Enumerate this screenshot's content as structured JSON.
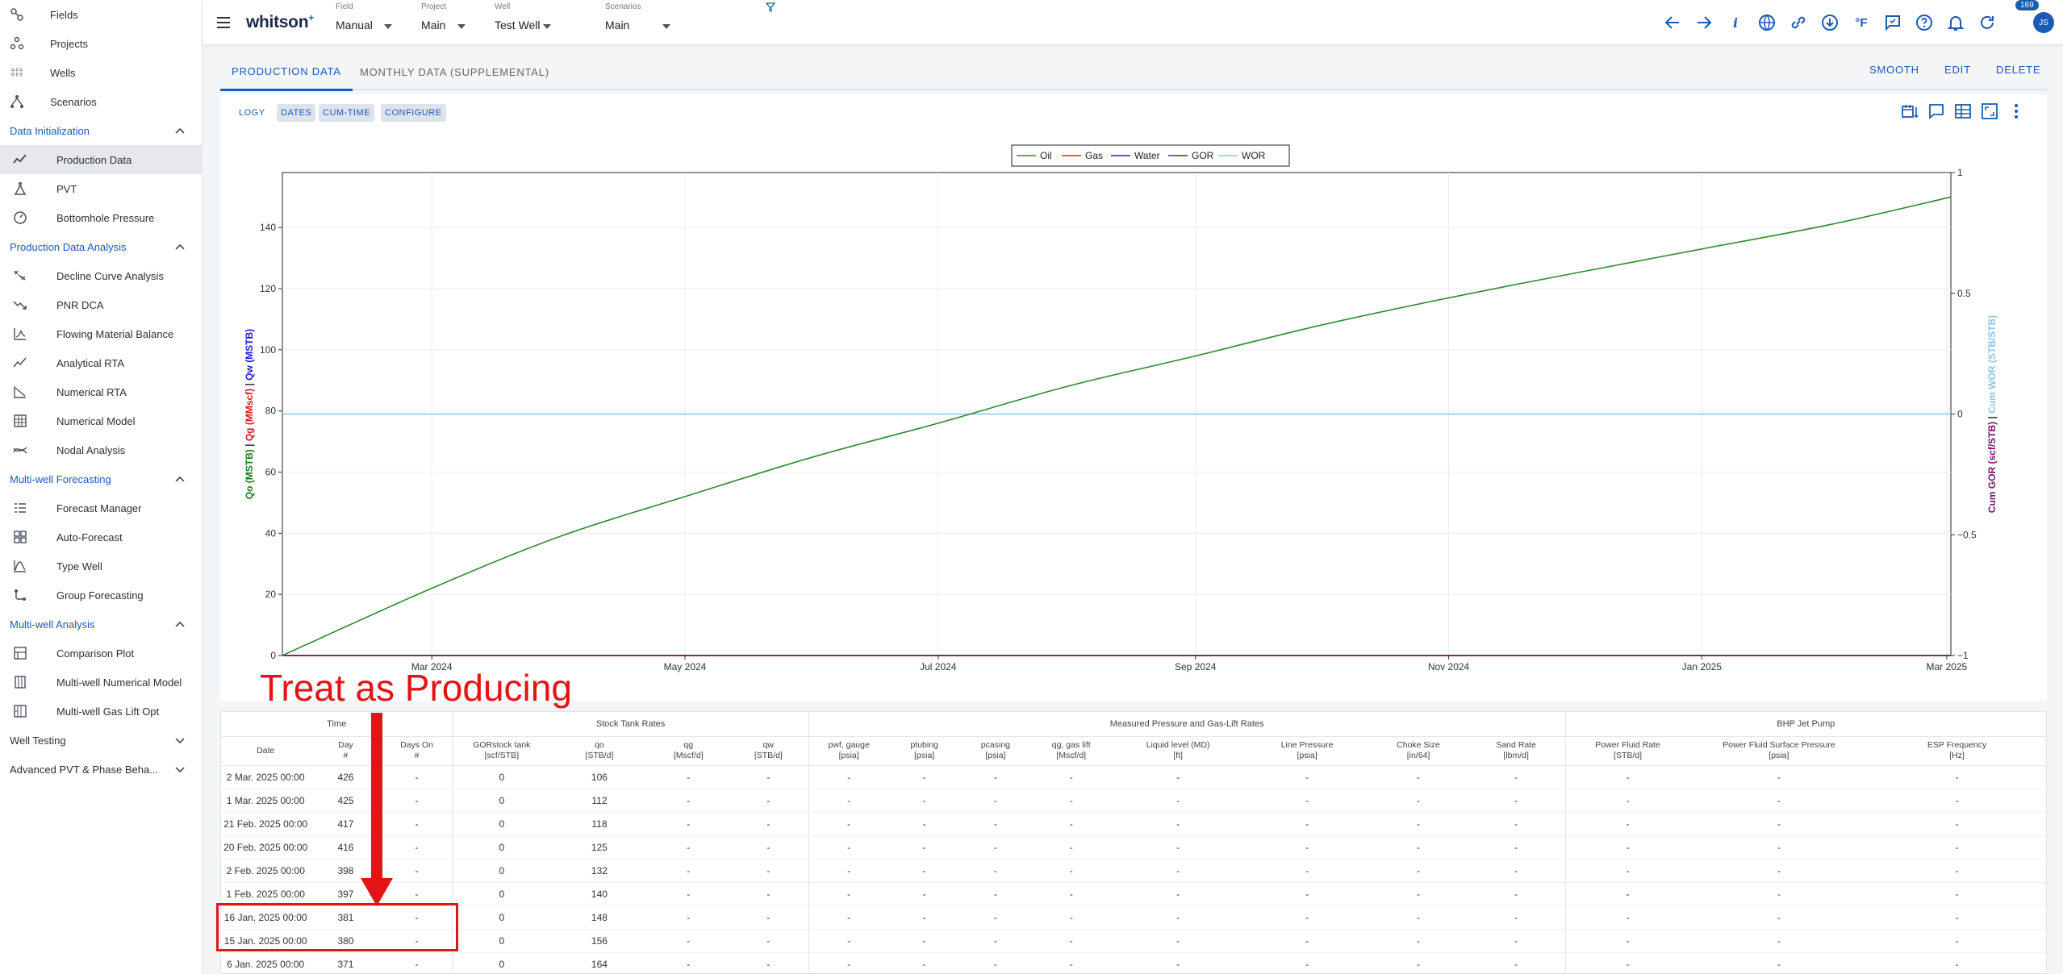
{
  "sidebar": {
    "top_items": [
      {
        "label": "Fields",
        "icon": "fields-icon"
      },
      {
        "label": "Projects",
        "icon": "projects-icon"
      },
      {
        "label": "Wells",
        "icon": "wells-icon"
      },
      {
        "label": "Scenarios",
        "icon": "scenarios-icon"
      }
    ],
    "sections": [
      {
        "title": "Data Initialization",
        "expanded": true,
        "items": [
          {
            "label": "Production Data",
            "icon": "production-chart-icon",
            "active": true
          },
          {
            "label": "PVT",
            "icon": "flask-icon"
          },
          {
            "label": "Bottomhole Pressure",
            "icon": "gauge-icon"
          }
        ]
      },
      {
        "title": "Production Data Analysis",
        "expanded": true,
        "items": [
          {
            "label": "Decline Curve Analysis",
            "icon": "decline-icon"
          },
          {
            "label": "PNR DCA",
            "icon": "trend-down-icon"
          },
          {
            "label": "Flowing Material Balance",
            "icon": "fmb-chart-icon"
          },
          {
            "label": "Analytical RTA",
            "icon": "line-chart-icon"
          },
          {
            "label": "Numerical RTA",
            "icon": "numerical-rta-icon"
          },
          {
            "label": "Numerical Model",
            "icon": "building-icon"
          },
          {
            "label": "Nodal Analysis",
            "icon": "nodal-icon"
          }
        ]
      },
      {
        "title": "Multi-well Forecasting",
        "expanded": true,
        "items": [
          {
            "label": "Forecast Manager",
            "icon": "list-icon"
          },
          {
            "label": "Auto-Forecast",
            "icon": "grid-icon"
          },
          {
            "label": "Type Well",
            "icon": "type-well-icon"
          },
          {
            "label": "Group Forecasting",
            "icon": "group-icon"
          }
        ]
      },
      {
        "title": "Multi-well Analysis",
        "expanded": true,
        "items": [
          {
            "label": "Comparison Plot",
            "icon": "comparison-icon"
          },
          {
            "label": "Multi-well Numerical Model",
            "icon": "multiwell-model-icon"
          },
          {
            "label": "Multi-well Gas Lift Opt",
            "icon": "gas-lift-icon"
          }
        ]
      },
      {
        "title": "Well Testing",
        "expanded": false,
        "items": []
      },
      {
        "title": "Advanced PVT & Phase Beha...",
        "expanded": false,
        "items": []
      }
    ]
  },
  "topbar": {
    "logo": "whitson",
    "logo_sup": "+",
    "selectors": [
      {
        "label": "Field",
        "value": "Manual"
      },
      {
        "label": "Project",
        "value": "Main"
      },
      {
        "label": "Well",
        "value": "Test Well"
      },
      {
        "label": "Scenarios",
        "value": "Main"
      }
    ],
    "notification_count": "169",
    "avatar_initials": "JS",
    "temp_unit": "°F",
    "info_glyph": "i"
  },
  "tabs": [
    {
      "label": "PRODUCTION DATA",
      "active": true
    },
    {
      "label": "MONTHLY DATA (SUPPLEMENTAL)",
      "active": false
    }
  ],
  "actions": {
    "smooth": "SMOOTH",
    "edit": "EDIT",
    "delete": "DELETE"
  },
  "chart_toolbar": {
    "logy": "LOGY",
    "dates": "DATES",
    "cumtime": "CUM-TIME",
    "configure": "CONFIGURE"
  },
  "chart_data": {
    "type": "line",
    "x_ticks": [
      "Mar 2024",
      "May 2024",
      "Jul 2024",
      "Sep 2024",
      "Nov 2024",
      "Jan 2025",
      "Mar 2025"
    ],
    "x_range": [
      "2024-01-25",
      "2025-03-02"
    ],
    "y_left": {
      "ticks": [
        0,
        20,
        40,
        60,
        80,
        100,
        120,
        140
      ],
      "range": [
        0,
        158
      ],
      "label_parts": [
        {
          "text": "Qo (MSTB)",
          "color": "#1a7a1a"
        },
        {
          "text": " | ",
          "color": "#333333"
        },
        {
          "text": "Qg (MMscf)",
          "color": "#d61a1a"
        },
        {
          "text": " | ",
          "color": "#333333"
        },
        {
          "text": "Qw (MSTB)",
          "color": "#1a1ad6"
        }
      ]
    },
    "y_right": {
      "ticks": [
        "1",
        "0.5",
        "0",
        "−0.5",
        "−1"
      ],
      "range": [
        -1,
        1
      ],
      "label_parts": [
        {
          "text": "Cum GOR (scf/STB)",
          "color": "#7a1070"
        },
        {
          "text": " | ",
          "color": "#333333"
        },
        {
          "text": "Cum WOR (STB/STB)",
          "color": "#8fc4ea"
        }
      ]
    },
    "legend": [
      "Oil",
      "Gas",
      "Water",
      "GOR",
      "WOR"
    ],
    "legend_position": "top-center",
    "grid": true,
    "series": [
      {
        "name": "Oil",
        "color": "#2e8b2e",
        "x": [
          "2024-01-25",
          "2024-03-01",
          "2024-04-01",
          "2024-05-01",
          "2024-06-01",
          "2024-07-01",
          "2024-08-01",
          "2024-09-01",
          "2024-10-01",
          "2024-11-01",
          "2024-12-01",
          "2025-01-01",
          "2025-02-01",
          "2025-03-02"
        ],
        "y": [
          0,
          22,
          39,
          52,
          65,
          76,
          88,
          98,
          108,
          117,
          125,
          133,
          141,
          150
        ]
      },
      {
        "name": "Gas",
        "color": "#e02020",
        "x": [
          "2024-01-25",
          "2025-03-02"
        ],
        "y": [
          0,
          0
        ]
      },
      {
        "name": "Water",
        "color": "#2020d0",
        "x": [
          "2024-01-25",
          "2025-03-02"
        ],
        "y": [
          0,
          0
        ]
      },
      {
        "name": "GOR",
        "color": "#7a1070",
        "axis": "right",
        "x": [
          "2024-01-25",
          "2025-03-02"
        ],
        "y": [
          -1,
          -1
        ]
      },
      {
        "name": "WOR",
        "color": "#8fc4ea",
        "axis": "right",
        "x": [
          "2024-01-25",
          "2025-03-02"
        ],
        "y": [
          0,
          0
        ]
      }
    ]
  },
  "annotation": {
    "text": "Treat as Producing"
  },
  "table": {
    "groups": {
      "time": "Time",
      "stock_tank": "Stock Tank Rates",
      "pressure": "Measured Pressure and Gas-Lift Rates",
      "bhp": "BHP Jet Pump"
    },
    "columns": [
      {
        "name": "Date",
        "unit": ""
      },
      {
        "name": "Day",
        "unit": "#"
      },
      {
        "name": "Days On",
        "unit": "#"
      },
      {
        "name": "GORstock tank",
        "unit": "[scf/STB]"
      },
      {
        "name": "qo",
        "unit": "[STB/d]"
      },
      {
        "name": "qg",
        "unit": "[Mscf/d]"
      },
      {
        "name": "qw",
        "unit": "[STB/d]"
      },
      {
        "name": "pwf, gauge",
        "unit": "[psia]"
      },
      {
        "name": "ptubing",
        "unit": "[psia]"
      },
      {
        "name": "pcasing",
        "unit": "[psia]"
      },
      {
        "name": "qg, gas lift",
        "unit": "[Mscf/d]"
      },
      {
        "name": "Liquid level (MD)",
        "unit": "[ft]"
      },
      {
        "name": "Line Pressure",
        "unit": "[psia]"
      },
      {
        "name": "Choke Size",
        "unit": "[in/64]"
      },
      {
        "name": "Sand Rate",
        "unit": "[lbm/d]"
      },
      {
        "name": "Power Fluid Rate",
        "unit": "[STB/d]"
      },
      {
        "name": "Power Fluid Surface Pressure",
        "unit": "[psia]"
      },
      {
        "name": "ESP Frequency",
        "unit": "[Hz]"
      }
    ],
    "rows": [
      [
        "2 Mar. 2025 00:00",
        "426",
        "-",
        "0",
        "106",
        "-",
        "-",
        "-",
        "-",
        "-",
        "-",
        "-",
        "-",
        "-",
        "-",
        "-",
        "-",
        "-"
      ],
      [
        "1 Mar. 2025 00:00",
        "425",
        "-",
        "0",
        "112",
        "-",
        "-",
        "-",
        "-",
        "-",
        "-",
        "-",
        "-",
        "-",
        "-",
        "-",
        "-",
        "-"
      ],
      [
        "21 Feb. 2025 00:00",
        "417",
        "-",
        "0",
        "118",
        "-",
        "-",
        "-",
        "-",
        "-",
        "-",
        "-",
        "-",
        "-",
        "-",
        "-",
        "-",
        "-"
      ],
      [
        "20 Feb. 2025 00:00",
        "416",
        "-",
        "0",
        "125",
        "-",
        "-",
        "-",
        "-",
        "-",
        "-",
        "-",
        "-",
        "-",
        "-",
        "-",
        "-",
        "-"
      ],
      [
        "2 Feb. 2025 00:00",
        "398",
        "-",
        "0",
        "132",
        "-",
        "-",
        "-",
        "-",
        "-",
        "-",
        "-",
        "-",
        "-",
        "-",
        "-",
        "-",
        "-"
      ],
      [
        "1 Feb. 2025 00:00",
        "397",
        "-",
        "0",
        "140",
        "-",
        "-",
        "-",
        "-",
        "-",
        "-",
        "-",
        "-",
        "-",
        "-",
        "-",
        "-",
        "-"
      ],
      [
        "16 Jan. 2025 00:00",
        "381",
        "-",
        "0",
        "148",
        "-",
        "-",
        "-",
        "-",
        "-",
        "-",
        "-",
        "-",
        "-",
        "-",
        "-",
        "-",
        "-"
      ],
      [
        "15 Jan. 2025 00:00",
        "380",
        "-",
        "0",
        "156",
        "-",
        "-",
        "-",
        "-",
        "-",
        "-",
        "-",
        "-",
        "-",
        "-",
        "-",
        "-",
        "-"
      ],
      [
        "6 Jan. 2025 00:00",
        "371",
        "-",
        "0",
        "164",
        "-",
        "-",
        "-",
        "-",
        "-",
        "-",
        "-",
        "-",
        "-",
        "-",
        "-",
        "-",
        "-"
      ]
    ]
  }
}
